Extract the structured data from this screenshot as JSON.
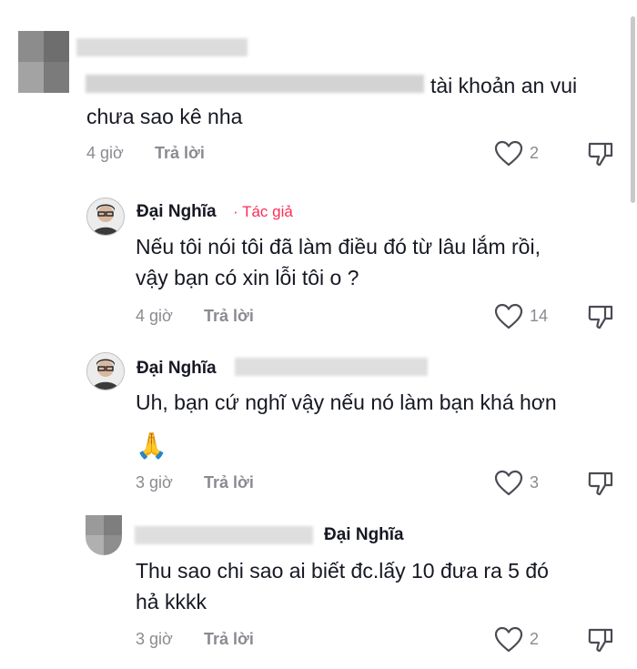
{
  "comments": [
    {
      "text_lines": [
        "tài khoản an vui",
        "chưa sao kê nha"
      ],
      "time": "4 giờ",
      "reply_label": "Trả lời",
      "likes": "2"
    },
    {
      "author": "Đại Nghĩa",
      "author_tag": "· Tác giả",
      "text_lines": [
        "Nếu tôi nói tôi đã làm điều đó từ lâu lắm rồi,",
        "vậy bạn có xin lỗi tôi o ?"
      ],
      "time": "4 giờ",
      "reply_label": "Trả lời",
      "likes": "14"
    },
    {
      "author": "Đại Nghĩa",
      "text_lines": [
        "Uh, bạn cứ nghĩ vậy nếu nó làm bạn khá hơn",
        "🙏"
      ],
      "time": "3 giờ",
      "reply_label": "Trả lời",
      "likes": "3"
    },
    {
      "reply_to": "Đại Nghĩa",
      "text_lines": [
        "Thu sao chi sao ai biết đc.lấy 10 đưa ra 5 đó",
        "hả kkkk"
      ],
      "time": "3 giờ",
      "reply_label": "Trả lời",
      "likes": "2"
    }
  ],
  "icons": {
    "like": "heart-outline-icon",
    "dislike": "thumbs-down-outline-icon"
  }
}
